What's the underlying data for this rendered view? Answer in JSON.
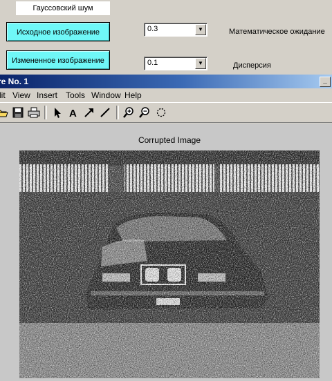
{
  "panel": {
    "title": "Гауссовский шум",
    "buttons": {
      "original": "Исходное изображение",
      "modified": "Измененное изображение"
    },
    "mean": {
      "value": "0.3",
      "label": "Математическое ожидание"
    },
    "variance": {
      "value": "0.1",
      "label": "Дисперсия"
    }
  },
  "window": {
    "title": "re No. 1",
    "minimize": "_"
  },
  "menu": [
    "lit",
    "View",
    "Insert",
    "Tools",
    "Window",
    "Help"
  ],
  "toolbar": {
    "icons": [
      "open-icon",
      "save-icon",
      "print-icon",
      "arrow-icon",
      "text-icon",
      "draw-arrow-icon",
      "line-icon",
      "zoom-in-icon",
      "zoom-out-icon",
      "rotate-icon"
    ]
  },
  "figure": {
    "title": "Corrupted Image"
  },
  "colors": {
    "button": "#6ff7f7",
    "titlebar_start": "#0a246a",
    "titlebar_end": "#a6caf0",
    "figure_bg": "#c8c8c8"
  }
}
